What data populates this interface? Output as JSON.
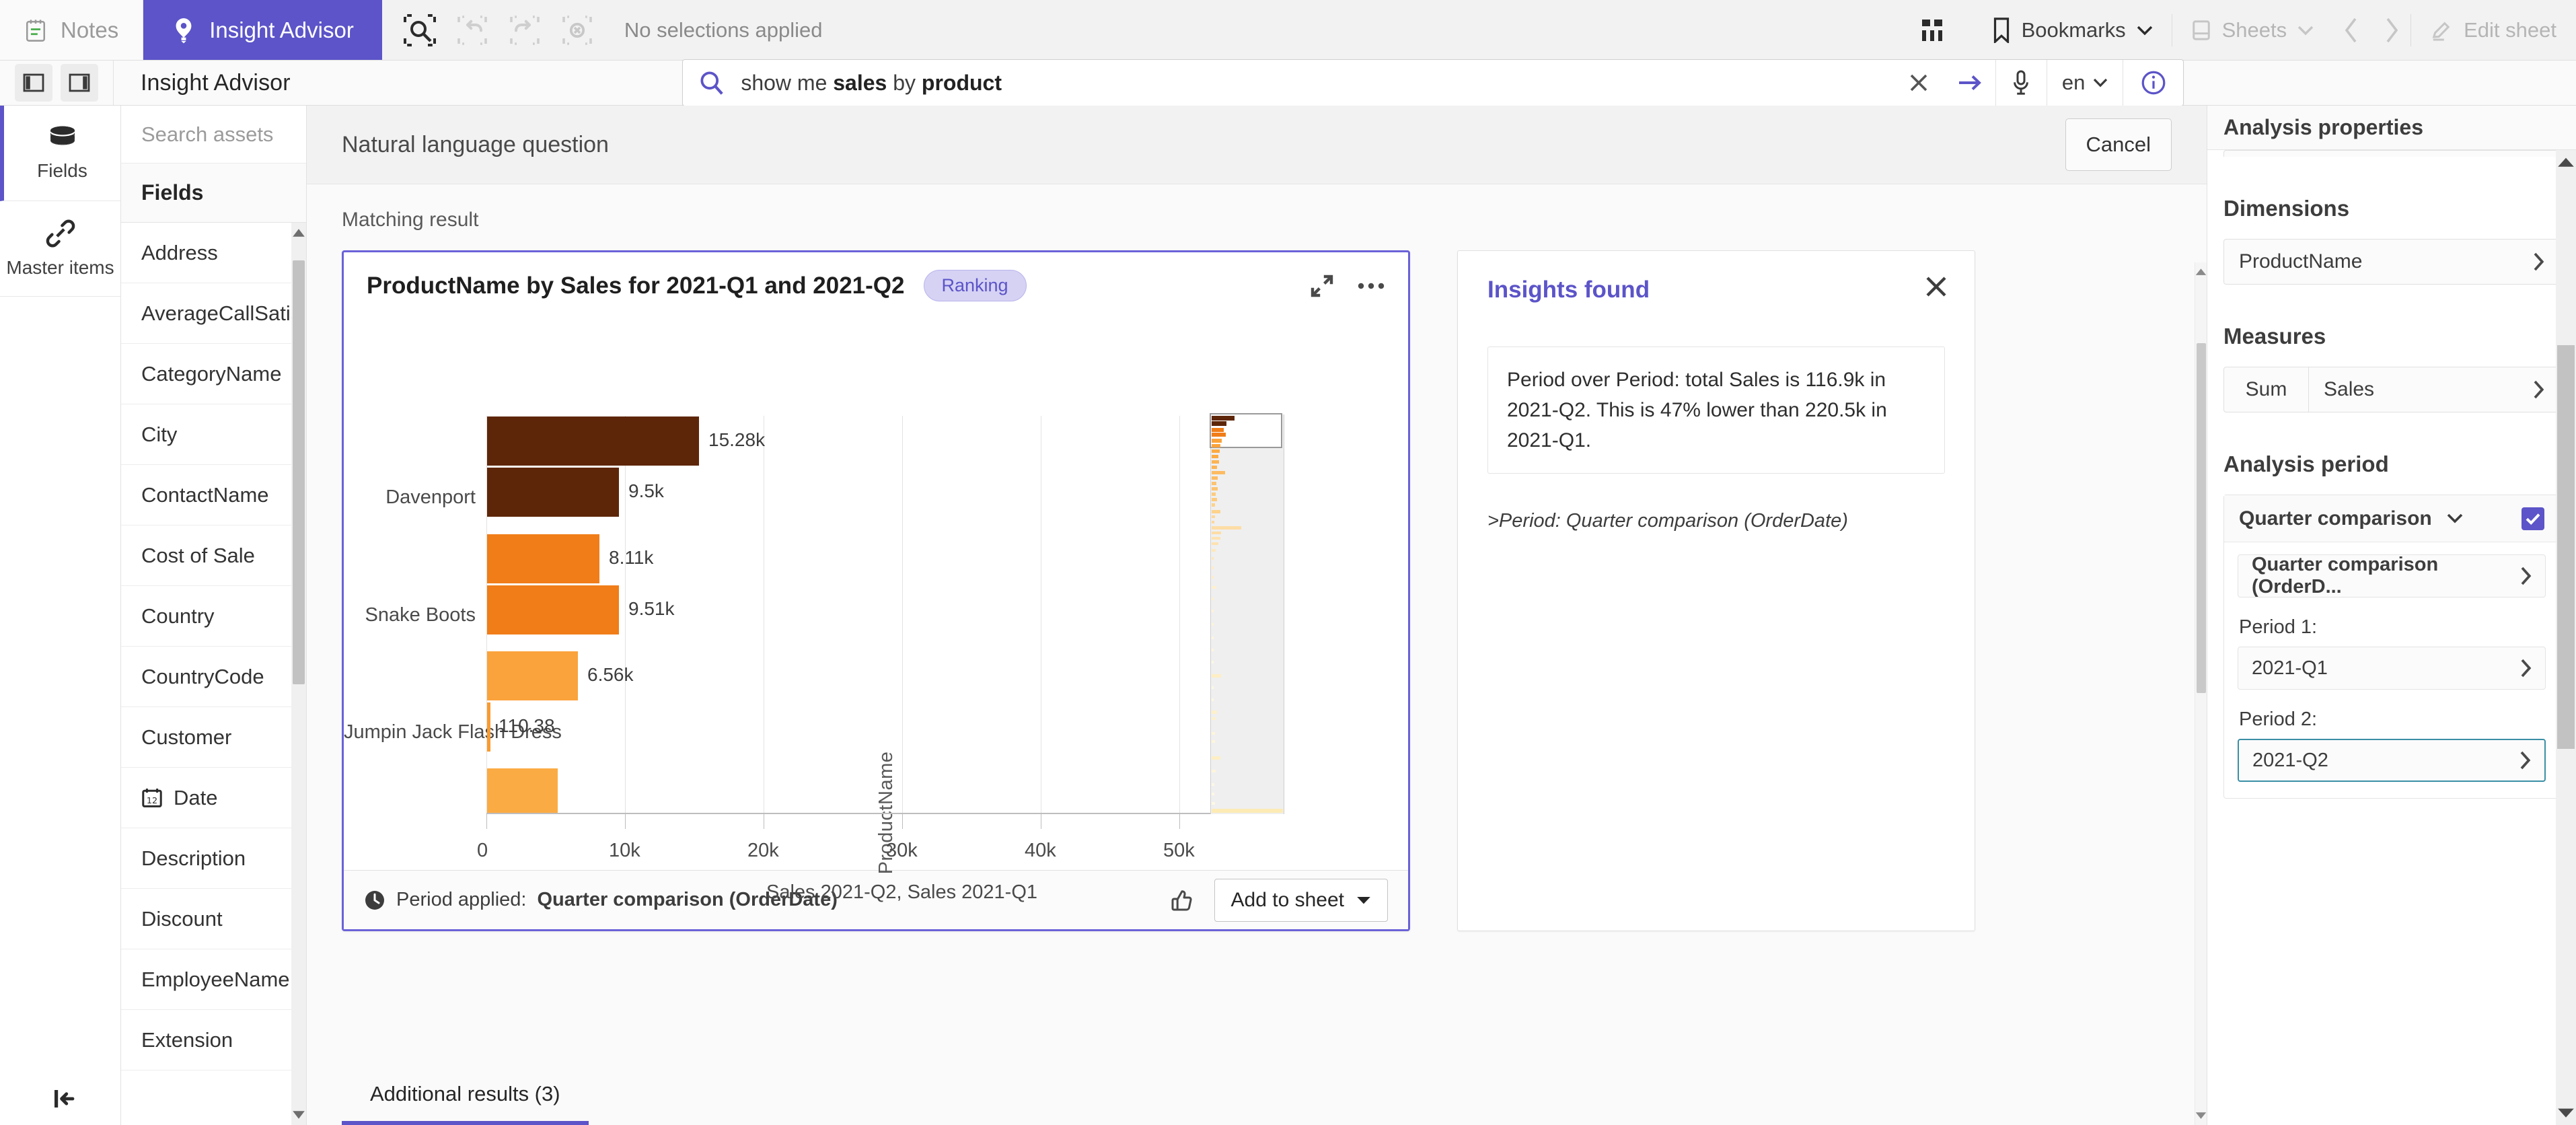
{
  "topbar": {
    "notes": "Notes",
    "app_title": "Insight Advisor",
    "selections_status": "No selections applied",
    "bookmarks": "Bookmarks",
    "sheets": "Sheets",
    "edit_sheet": "Edit sheet",
    "accent_color": "#5c54c8"
  },
  "subheader": {
    "title": "Insight Advisor",
    "search": {
      "value_plain": "show me sales by product",
      "value_prefix": "show me ",
      "value_entity1": "sales",
      "value_mid": " by ",
      "value_entity2": "product",
      "language": "en"
    }
  },
  "rail": {
    "items": [
      {
        "label": "Fields",
        "icon": "database-icon"
      },
      {
        "label": "Master items",
        "icon": "link-icon"
      }
    ]
  },
  "assets": {
    "search_placeholder": "Search assets",
    "section_header": "Fields",
    "fields": [
      {
        "label": "Address",
        "icon": ""
      },
      {
        "label": "AverageCallSatisfaction",
        "icon": ""
      },
      {
        "label": "CategoryName",
        "icon": ""
      },
      {
        "label": "City",
        "icon": ""
      },
      {
        "label": "ContactName",
        "icon": ""
      },
      {
        "label": "Cost of Sale",
        "icon": ""
      },
      {
        "label": "Country",
        "icon": ""
      },
      {
        "label": "CountryCode",
        "icon": ""
      },
      {
        "label": "Customer",
        "icon": ""
      },
      {
        "label": "Date",
        "icon": "calendar-icon"
      },
      {
        "label": "Description",
        "icon": ""
      },
      {
        "label": "Discount",
        "icon": ""
      },
      {
        "label": "EmployeeName",
        "icon": ""
      },
      {
        "label": "Extension",
        "icon": ""
      }
    ]
  },
  "main": {
    "nlq_title": "Natural language question",
    "cancel_label": "Cancel",
    "matching_result_label": "Matching result",
    "additional_results_tab": "Additional results (3)"
  },
  "chart_card": {
    "title": "ProductName by Sales for 2021-Q1 and 2021-Q2",
    "badge": "Ranking",
    "footer_prefix": "Period applied:",
    "footer_value": "Quarter comparison (OrderDate)",
    "add_to_sheet": "Add to sheet"
  },
  "insights": {
    "title": "Insights found",
    "text": "Period over Period: total Sales is 116.9k in 2021-Q2. This is 47% lower than 220.5k in 2021-Q1.",
    "subtext": ">Period: Quarter comparison (OrderDate)"
  },
  "props": {
    "header": "Analysis properties",
    "dimensions_title": "Dimensions",
    "dimension": "ProductName",
    "measures_title": "Measures",
    "measure_agg": "Sum",
    "measure_field": "Sales",
    "analysis_period_title": "Analysis period",
    "period_type": "Quarter comparison",
    "period_field": "Quarter comparison (OrderD...",
    "period1_label": "Period 1:",
    "period1_value": "2021-Q1",
    "period2_label": "Period 2:",
    "period2_value": "2021-Q2"
  },
  "chart_data": {
    "type": "bar",
    "orientation": "horizontal",
    "title": "ProductName by Sales for 2021-Q1 and 2021-Q2",
    "xlabel": "Sales 2021-Q2, Sales 2021-Q1",
    "ylabel": "ProductName",
    "xlim": [
      0,
      55000
    ],
    "xticks": [
      0,
      10000,
      20000,
      30000,
      40000,
      50000
    ],
    "xtick_labels": [
      "0",
      "10k",
      "20k",
      "30k",
      "40k",
      "50k"
    ],
    "grid": true,
    "legend": "none",
    "series": [
      {
        "name": "Sales 2021-Q2"
      },
      {
        "name": "Sales 2021-Q1"
      }
    ],
    "categories": [
      "Davenport",
      "Snake Boots",
      "Jumpin Jack Flash Dress",
      ""
    ],
    "bars": [
      {
        "category": "Davenport",
        "series": "Sales 2021-Q2",
        "value": 15280,
        "label": "15.28k",
        "color": "#5e2609"
      },
      {
        "category": "Davenport",
        "series": "Sales 2021-Q1",
        "value": 9500,
        "label": "9.5k",
        "color": "#5e2609"
      },
      {
        "category": "Snake Boots",
        "series": "Sales 2021-Q2",
        "value": 8110,
        "label": "8.11k",
        "color": "#f07d18"
      },
      {
        "category": "Snake Boots",
        "series": "Sales 2021-Q1",
        "value": 9510,
        "label": "9.51k",
        "color": "#f07d18"
      },
      {
        "category": "Jumpin Jack Flash Dress",
        "series": "Sales 2021-Q2",
        "value": 6560,
        "label": "6.56k",
        "color": "#faa33c"
      },
      {
        "category": "Jumpin Jack Flash Dress",
        "series": "Sales 2021-Q1",
        "value": 110.38,
        "label": "110.38",
        "color": "#f99b2e"
      },
      {
        "category": "",
        "series": "Sales 2021-Q2",
        "value": 5100,
        "label": "",
        "color": "#fbab43"
      }
    ]
  }
}
